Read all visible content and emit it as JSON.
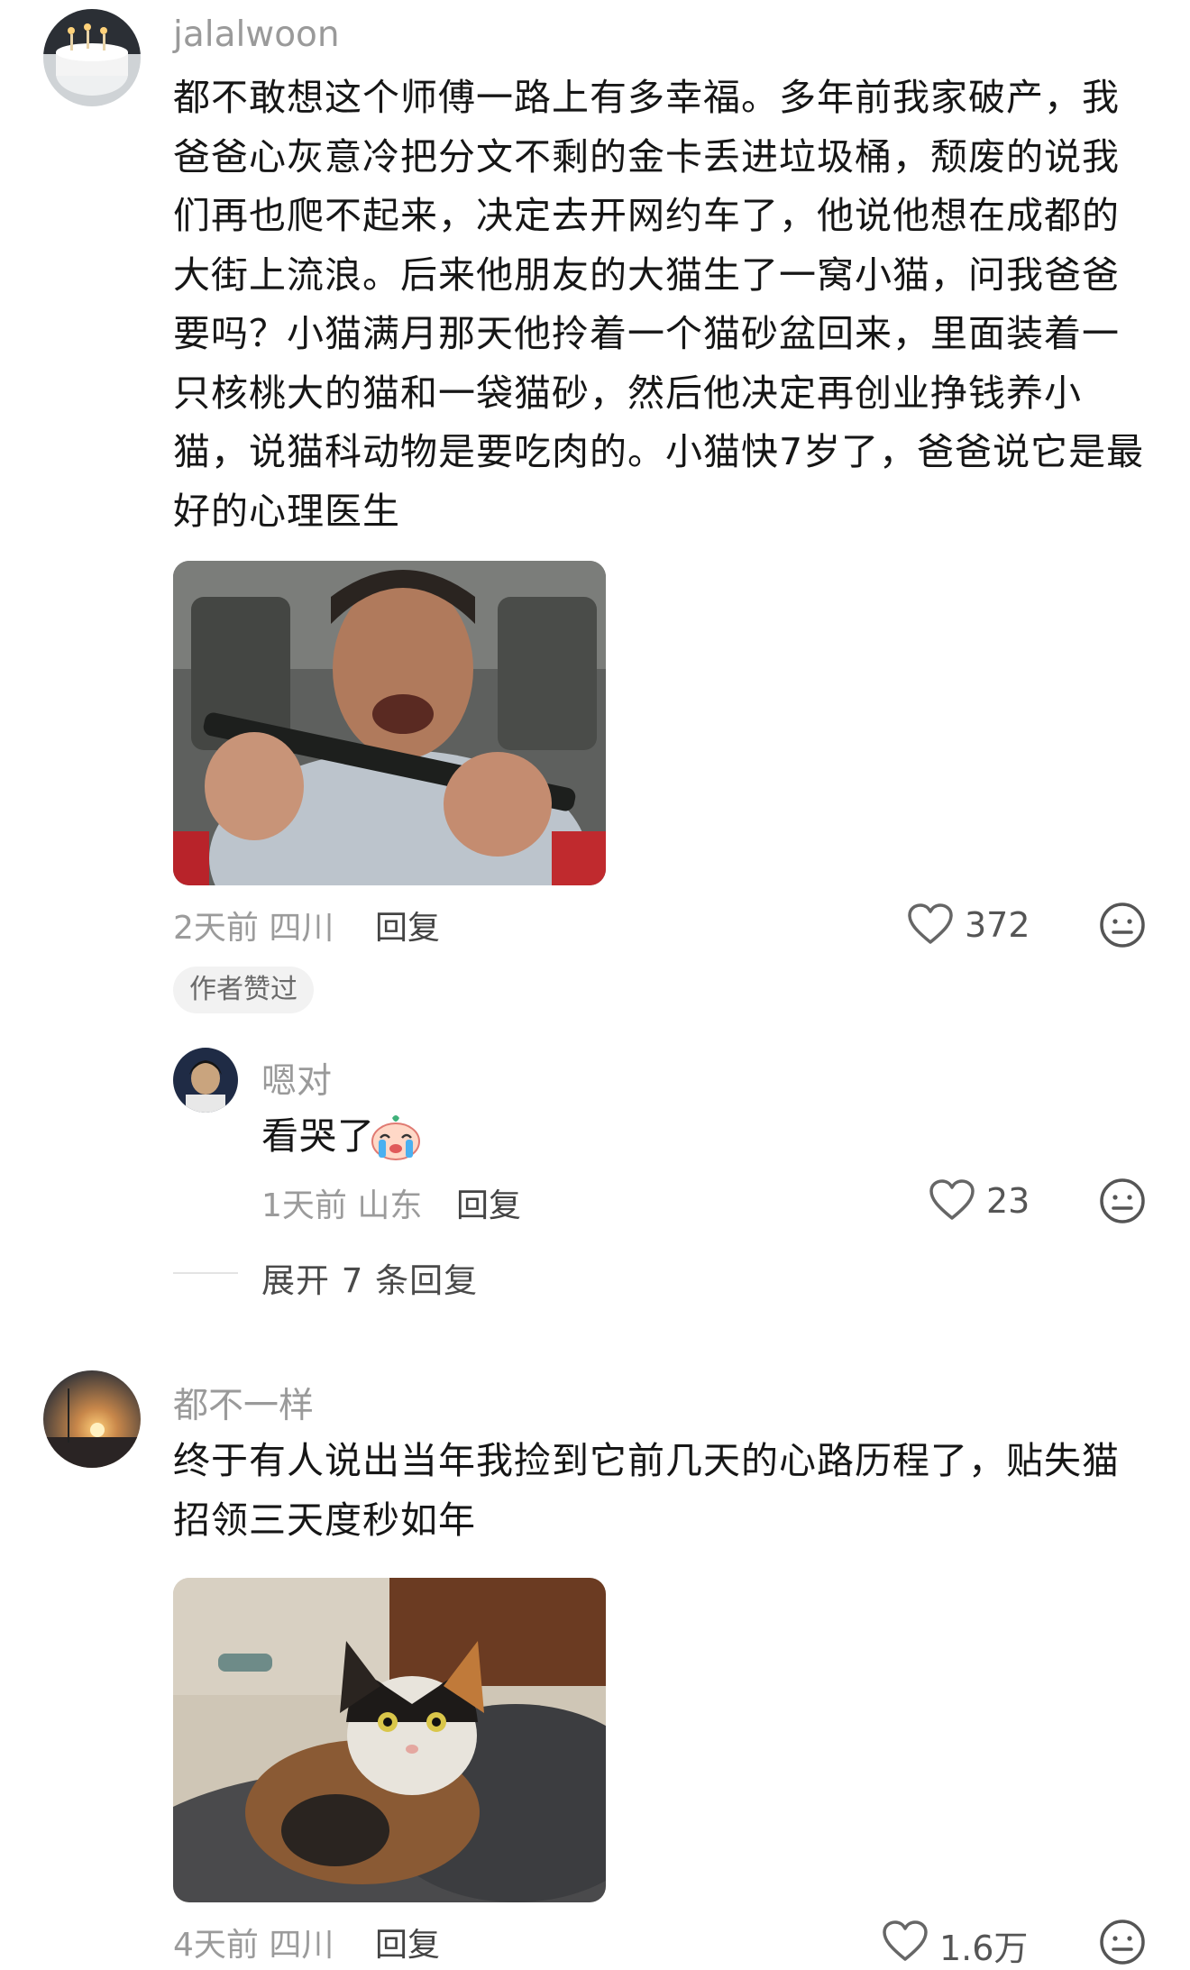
{
  "comments": [
    {
      "username": "jalalwoon",
      "text": "都不敢想这个师傅一路上有多幸福。多年前我家破产，我爸爸心灰意冷把分文不剩的金卡丢进垃圾桶，颓废的说我们再也爬不起来，决定去开网约车了，他说他想在成都的大街上流浪。后来他朋友的大猫生了一窝小猫，问我爸爸要吗？小猫满月那天他拎着一个猫砂盆回来，里面装着一只核桃大的猫和一袋猫砂，然后他决定再创业挣钱养小猫，说猫科动物是要吃肉的。小猫快7岁了，爸爸说它是最好的心理医生",
      "time_location": "2天前 四川",
      "reply_label": "回复",
      "likes": "372",
      "badge": "作者赞过",
      "replies": [
        {
          "username": "嗯对",
          "text": "看哭了",
          "emoji": "crying-face-sticker",
          "time_location": "1天前 山东",
          "reply_label": "回复",
          "likes": "23"
        }
      ],
      "expand_label": "展开 7 条回复"
    },
    {
      "username": "都不一样",
      "text": "终于有人说出当年我捡到它前几天的心路历程了，贴失猫招领三天度秒如年",
      "time_location": "4天前 四川",
      "reply_label": "回复",
      "likes": "1.6万"
    }
  ],
  "icons": {
    "like": "heart-outline-icon",
    "dislike": "meh-face-icon"
  },
  "colors": {
    "username": "#9a9a9a",
    "text": "#161616",
    "meta": "#9b9b9b",
    "badge_bg": "#f2f2f2"
  }
}
